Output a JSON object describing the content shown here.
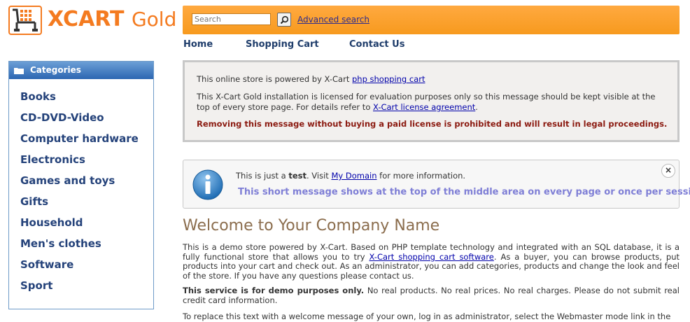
{
  "logo": {
    "brand": "XCART",
    "edition": "Gold",
    "icon": "cart-logo-icon",
    "color": "#f47b20"
  },
  "search": {
    "placeholder": "Search",
    "button_icon": "search-icon",
    "advanced_label": "Advanced search"
  },
  "nav": {
    "items": [
      "Home",
      "Shopping Cart",
      "Contact Us"
    ]
  },
  "categories": {
    "title": "Categories",
    "icon": "folder-icon",
    "items": [
      "Books",
      "CD-DVD-Video",
      "Computer hardware",
      "Electronics",
      "Games and toys",
      "Gifts",
      "Household",
      "Men's clothes",
      "Software",
      "Sport"
    ]
  },
  "license": {
    "line1_prefix": "This online store is powered by X-Cart ",
    "line1_link": "php shopping cart",
    "line2_part1": "This X-Cart Gold installation is licensed for evaluation purposes only so this message should be kept visible at the",
    "line2_part2": "top of every store page. For details refer to ",
    "line2_link": "X-Cart license agreement",
    "line2_end": ".",
    "warning": "Removing this message without buying a paid license is prohibited and will result in legal proceedings."
  },
  "info_message": {
    "icon": "info-icon",
    "text_prefix": "This is just a ",
    "text_bold": "test",
    "text_mid": ". Visit ",
    "link": "My Domain",
    "text_end": " for more information.",
    "highlight": "This short message shows at the top of the middle area on every page or once per session",
    "close_icon": "close-icon",
    "close_glyph": "×"
  },
  "welcome": {
    "title": "Welcome to Your Company Name",
    "p1_start": "This is a demo store powered by X-Cart. Based on PHP template technology and integrated with an SQL database, it is a fully functional store that allows you to try ",
    "p1_link": "X-Cart shopping cart software",
    "p1_end": ". As a buyer, you can browse products, put products into your cart and check out. As an administrator, you can add categories, products and change the look and feel of the store. If you have any questions please contact us.",
    "p2_bold": "This service is for demo purposes only.",
    "p2_rest": " No real products. No real prices. No real charges. Please do not submit real credit card information.",
    "p3": "To replace this text with a welcome message of your own, log in as administrator, select the Webmaster mode link in the"
  }
}
